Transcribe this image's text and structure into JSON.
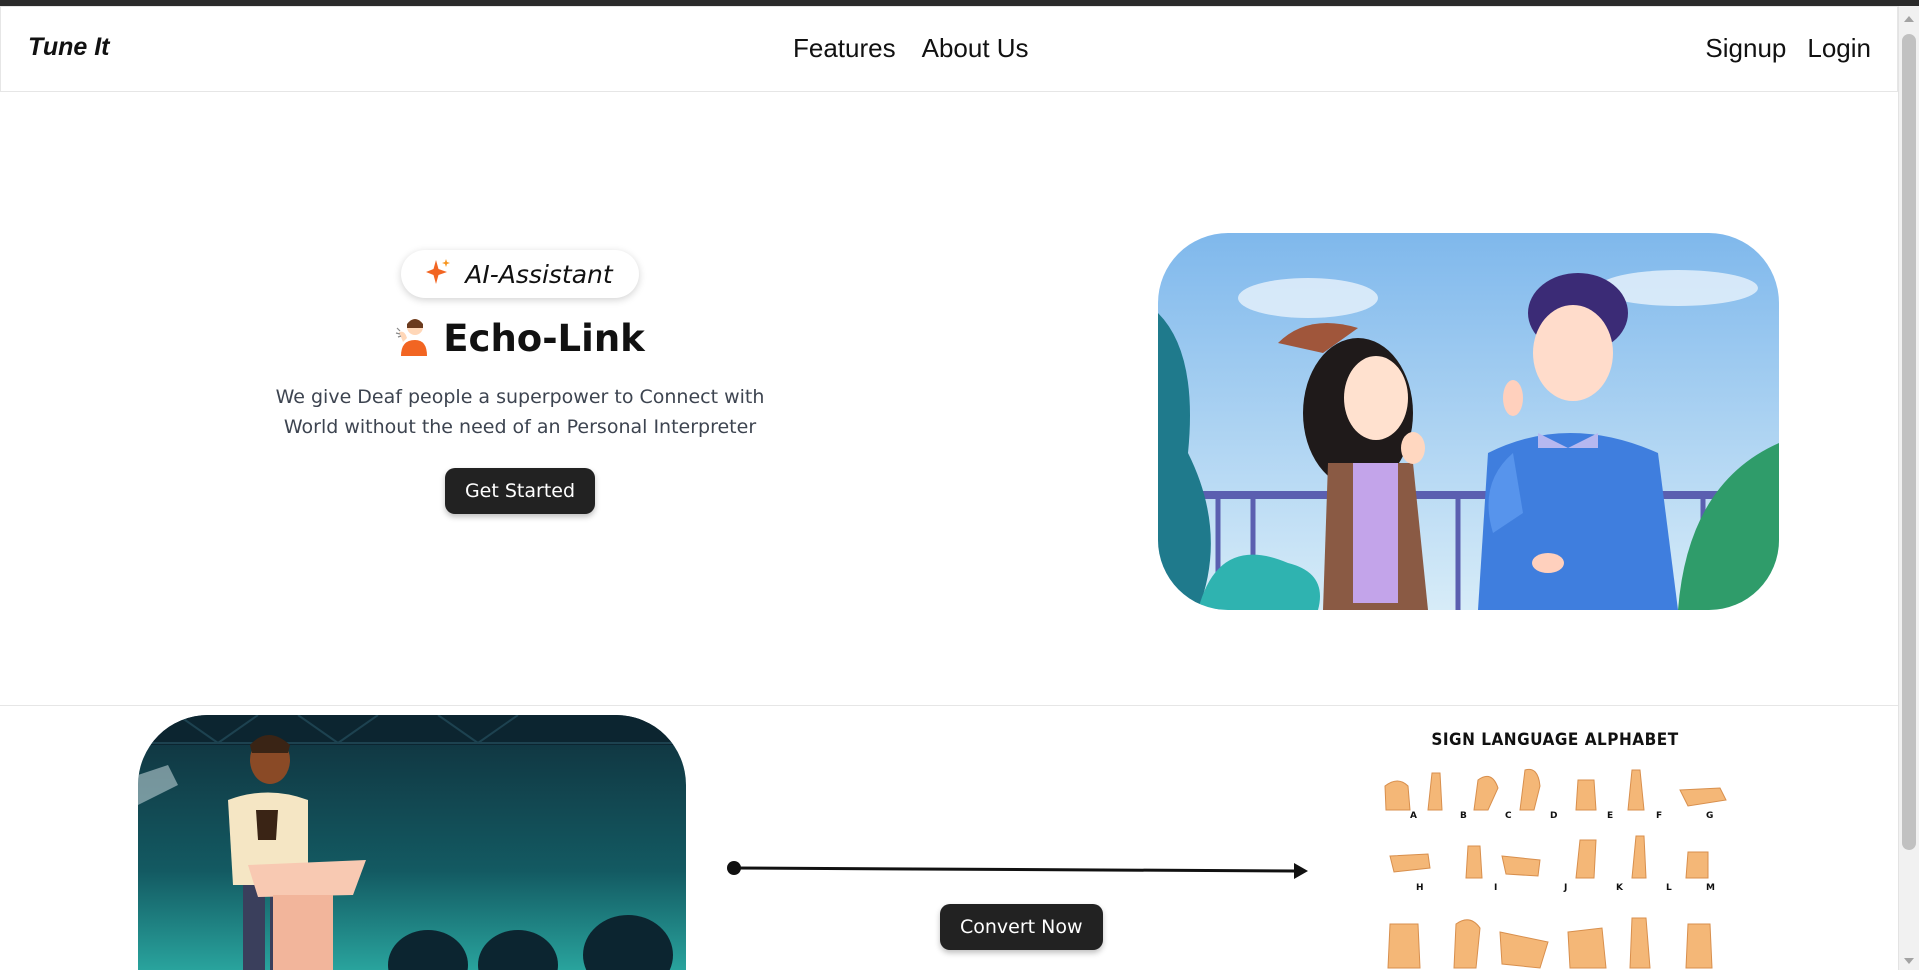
{
  "nav": {
    "brand": "Tune It",
    "center_links": [
      "Features",
      "About Us"
    ],
    "right_links": [
      "Signup",
      "Login"
    ]
  },
  "hero": {
    "badge_icon": "sparkle-icon",
    "badge_label": "AI-Assistant",
    "title_icon": "signing-person-icon",
    "title": "Echo-Link",
    "description": "We give Deaf people a superpower to Connect with World without the need of an Personal Interpreter",
    "cta_label": "Get Started",
    "image": "two-people-signing-illustration"
  },
  "converter": {
    "left_image": "speaker-at-podium-illustration",
    "arrow_icon": "arrow-right-icon",
    "convert_label": "Convert Now",
    "right_image_title": "SIGN LANGUAGE ALPHABET",
    "alphabet_letters_row1": [
      "A",
      "B",
      "C",
      "D",
      "E",
      "F",
      "G"
    ],
    "alphabet_letters_row2": [
      "H",
      "I",
      "J",
      "K",
      "L",
      "M"
    ]
  },
  "colors": {
    "accent_sparkle": "#f26522",
    "button_bg": "#222222",
    "text_muted": "#3d4450"
  }
}
